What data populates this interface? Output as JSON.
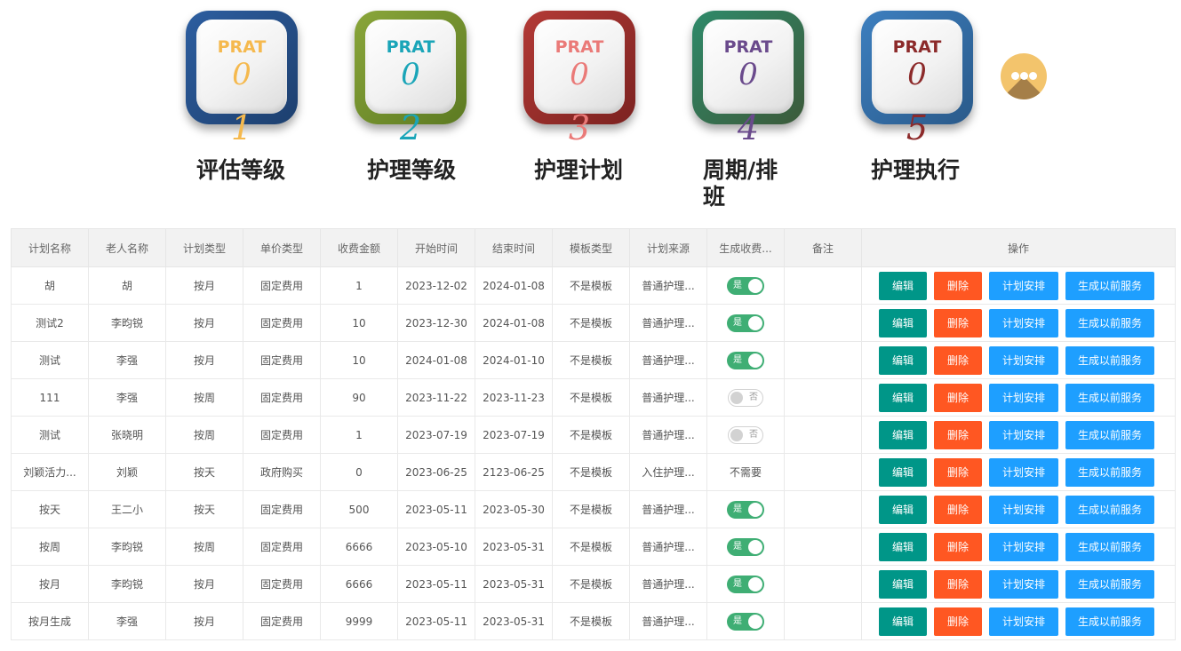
{
  "steps": [
    {
      "prat": "PRAT",
      "zero": "0",
      "num": "1",
      "label": "评估等级",
      "color": "#f5b94e",
      "border_from": "#2d5ea0",
      "border_to": "#1d3f6e"
    },
    {
      "prat": "PRAT",
      "zero": "0",
      "num": "2",
      "label": "护理等级",
      "color": "#1aa5b8",
      "border_from": "#8aa63a",
      "border_to": "#5c7a22"
    },
    {
      "prat": "PRAT",
      "zero": "0",
      "num": "3",
      "label": "护理计划",
      "color": "#ea7a78",
      "border_from": "#b33a36",
      "border_to": "#7c2220"
    },
    {
      "prat": "PRAT",
      "zero": "0",
      "num": "4",
      "label": "周期/排班",
      "color": "#6a4a8c",
      "border_from": "#2f8a6a",
      "border_to": "#3c5a3a"
    },
    {
      "prat": "PRAT",
      "zero": "0",
      "num": "5",
      "label": "护理执行",
      "color": "#8c2a2a",
      "border_from": "#3d7fbf",
      "border_to": "#2a5a8a"
    }
  ],
  "table": {
    "headers": [
      "计划名称",
      "老人名称",
      "计划类型",
      "单价类型",
      "收费金额",
      "开始时间",
      "结束时间",
      "模板类型",
      "计划来源",
      "生成收费...",
      "备注",
      "操作"
    ],
    "actions": {
      "edit": "编辑",
      "delete": "删除",
      "plan": "计划安排",
      "generate": "生成以前服务"
    },
    "switch_on_label": "是",
    "switch_off_label": "否",
    "rows": [
      {
        "name": "胡",
        "elder": "胡",
        "type": "按月",
        "price_type": "固定费用",
        "amount": "1",
        "start": "2023-12-02",
        "end": "2024-01-08",
        "template": "不是模板",
        "source": "普通护理...",
        "charge": "on",
        "charge_text": "",
        "note": ""
      },
      {
        "name": "测试2",
        "elder": "李昀锐",
        "type": "按月",
        "price_type": "固定费用",
        "amount": "10",
        "start": "2023-12-30",
        "end": "2024-01-08",
        "template": "不是模板",
        "source": "普通护理...",
        "charge": "on",
        "charge_text": "",
        "note": ""
      },
      {
        "name": "测试",
        "elder": "李强",
        "type": "按月",
        "price_type": "固定费用",
        "amount": "10",
        "start": "2024-01-08",
        "end": "2024-01-10",
        "template": "不是模板",
        "source": "普通护理...",
        "charge": "on",
        "charge_text": "",
        "note": ""
      },
      {
        "name": "111",
        "elder": "李强",
        "type": "按周",
        "price_type": "固定费用",
        "amount": "90",
        "start": "2023-11-22",
        "end": "2023-11-23",
        "template": "不是模板",
        "source": "普通护理...",
        "charge": "off",
        "charge_text": "",
        "note": ""
      },
      {
        "name": "测试",
        "elder": "张晓明",
        "type": "按周",
        "price_type": "固定费用",
        "amount": "1",
        "start": "2023-07-19",
        "end": "2023-07-19",
        "template": "不是模板",
        "source": "普通护理...",
        "charge": "off",
        "charge_text": "",
        "note": ""
      },
      {
        "name": "刘颖活力...",
        "elder": "刘颖",
        "type": "按天",
        "price_type": "政府购买",
        "amount": "0",
        "start": "2023-06-25",
        "end": "2123-06-25",
        "template": "不是模板",
        "source": "入住护理...",
        "charge": "text",
        "charge_text": "不需要",
        "note": ""
      },
      {
        "name": "按天",
        "elder": "王二小",
        "type": "按天",
        "price_type": "固定费用",
        "amount": "500",
        "start": "2023-05-11",
        "end": "2023-05-30",
        "template": "不是模板",
        "source": "普通护理...",
        "charge": "on",
        "charge_text": "",
        "note": ""
      },
      {
        "name": "按周",
        "elder": "李昀锐",
        "type": "按周",
        "price_type": "固定费用",
        "amount": "6666",
        "start": "2023-05-10",
        "end": "2023-05-31",
        "template": "不是模板",
        "source": "普通护理...",
        "charge": "on",
        "charge_text": "",
        "note": ""
      },
      {
        "name": "按月",
        "elder": "李昀锐",
        "type": "按月",
        "price_type": "固定费用",
        "amount": "6666",
        "start": "2023-05-11",
        "end": "2023-05-31",
        "template": "不是模板",
        "source": "普通护理...",
        "charge": "on",
        "charge_text": "",
        "note": ""
      },
      {
        "name": "按月生成",
        "elder": "李强",
        "type": "按月",
        "price_type": "固定费用",
        "amount": "9999",
        "start": "2023-05-11",
        "end": "2023-05-31",
        "template": "不是模板",
        "source": "普通护理...",
        "charge": "on",
        "charge_text": "",
        "note": ""
      }
    ]
  },
  "more_icon": "more-dots-icon"
}
